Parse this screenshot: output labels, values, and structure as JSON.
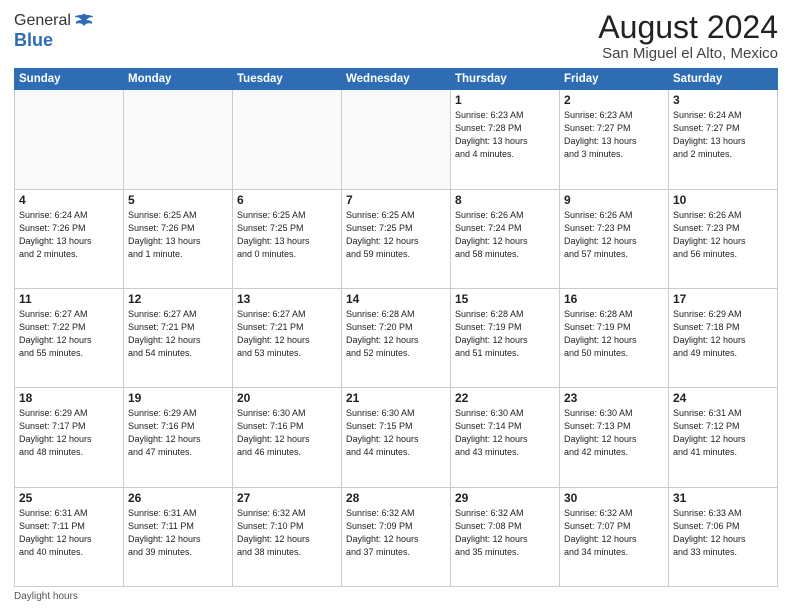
{
  "header": {
    "logo_general": "General",
    "logo_blue": "Blue",
    "month_title": "August 2024",
    "location": "San Miguel el Alto, Mexico"
  },
  "footer": {
    "daylight_label": "Daylight hours"
  },
  "days_of_week": [
    "Sunday",
    "Monday",
    "Tuesday",
    "Wednesday",
    "Thursday",
    "Friday",
    "Saturday"
  ],
  "weeks": [
    [
      {
        "num": "",
        "info": ""
      },
      {
        "num": "",
        "info": ""
      },
      {
        "num": "",
        "info": ""
      },
      {
        "num": "",
        "info": ""
      },
      {
        "num": "1",
        "info": "Sunrise: 6:23 AM\nSunset: 7:28 PM\nDaylight: 13 hours\nand 4 minutes."
      },
      {
        "num": "2",
        "info": "Sunrise: 6:23 AM\nSunset: 7:27 PM\nDaylight: 13 hours\nand 3 minutes."
      },
      {
        "num": "3",
        "info": "Sunrise: 6:24 AM\nSunset: 7:27 PM\nDaylight: 13 hours\nand 2 minutes."
      }
    ],
    [
      {
        "num": "4",
        "info": "Sunrise: 6:24 AM\nSunset: 7:26 PM\nDaylight: 13 hours\nand 2 minutes."
      },
      {
        "num": "5",
        "info": "Sunrise: 6:25 AM\nSunset: 7:26 PM\nDaylight: 13 hours\nand 1 minute."
      },
      {
        "num": "6",
        "info": "Sunrise: 6:25 AM\nSunset: 7:25 PM\nDaylight: 13 hours\nand 0 minutes."
      },
      {
        "num": "7",
        "info": "Sunrise: 6:25 AM\nSunset: 7:25 PM\nDaylight: 12 hours\nand 59 minutes."
      },
      {
        "num": "8",
        "info": "Sunrise: 6:26 AM\nSunset: 7:24 PM\nDaylight: 12 hours\nand 58 minutes."
      },
      {
        "num": "9",
        "info": "Sunrise: 6:26 AM\nSunset: 7:23 PM\nDaylight: 12 hours\nand 57 minutes."
      },
      {
        "num": "10",
        "info": "Sunrise: 6:26 AM\nSunset: 7:23 PM\nDaylight: 12 hours\nand 56 minutes."
      }
    ],
    [
      {
        "num": "11",
        "info": "Sunrise: 6:27 AM\nSunset: 7:22 PM\nDaylight: 12 hours\nand 55 minutes."
      },
      {
        "num": "12",
        "info": "Sunrise: 6:27 AM\nSunset: 7:21 PM\nDaylight: 12 hours\nand 54 minutes."
      },
      {
        "num": "13",
        "info": "Sunrise: 6:27 AM\nSunset: 7:21 PM\nDaylight: 12 hours\nand 53 minutes."
      },
      {
        "num": "14",
        "info": "Sunrise: 6:28 AM\nSunset: 7:20 PM\nDaylight: 12 hours\nand 52 minutes."
      },
      {
        "num": "15",
        "info": "Sunrise: 6:28 AM\nSunset: 7:19 PM\nDaylight: 12 hours\nand 51 minutes."
      },
      {
        "num": "16",
        "info": "Sunrise: 6:28 AM\nSunset: 7:19 PM\nDaylight: 12 hours\nand 50 minutes."
      },
      {
        "num": "17",
        "info": "Sunrise: 6:29 AM\nSunset: 7:18 PM\nDaylight: 12 hours\nand 49 minutes."
      }
    ],
    [
      {
        "num": "18",
        "info": "Sunrise: 6:29 AM\nSunset: 7:17 PM\nDaylight: 12 hours\nand 48 minutes."
      },
      {
        "num": "19",
        "info": "Sunrise: 6:29 AM\nSunset: 7:16 PM\nDaylight: 12 hours\nand 47 minutes."
      },
      {
        "num": "20",
        "info": "Sunrise: 6:30 AM\nSunset: 7:16 PM\nDaylight: 12 hours\nand 46 minutes."
      },
      {
        "num": "21",
        "info": "Sunrise: 6:30 AM\nSunset: 7:15 PM\nDaylight: 12 hours\nand 44 minutes."
      },
      {
        "num": "22",
        "info": "Sunrise: 6:30 AM\nSunset: 7:14 PM\nDaylight: 12 hours\nand 43 minutes."
      },
      {
        "num": "23",
        "info": "Sunrise: 6:30 AM\nSunset: 7:13 PM\nDaylight: 12 hours\nand 42 minutes."
      },
      {
        "num": "24",
        "info": "Sunrise: 6:31 AM\nSunset: 7:12 PM\nDaylight: 12 hours\nand 41 minutes."
      }
    ],
    [
      {
        "num": "25",
        "info": "Sunrise: 6:31 AM\nSunset: 7:11 PM\nDaylight: 12 hours\nand 40 minutes."
      },
      {
        "num": "26",
        "info": "Sunrise: 6:31 AM\nSunset: 7:11 PM\nDaylight: 12 hours\nand 39 minutes."
      },
      {
        "num": "27",
        "info": "Sunrise: 6:32 AM\nSunset: 7:10 PM\nDaylight: 12 hours\nand 38 minutes."
      },
      {
        "num": "28",
        "info": "Sunrise: 6:32 AM\nSunset: 7:09 PM\nDaylight: 12 hours\nand 37 minutes."
      },
      {
        "num": "29",
        "info": "Sunrise: 6:32 AM\nSunset: 7:08 PM\nDaylight: 12 hours\nand 35 minutes."
      },
      {
        "num": "30",
        "info": "Sunrise: 6:32 AM\nSunset: 7:07 PM\nDaylight: 12 hours\nand 34 minutes."
      },
      {
        "num": "31",
        "info": "Sunrise: 6:33 AM\nSunset: 7:06 PM\nDaylight: 12 hours\nand 33 minutes."
      }
    ]
  ]
}
